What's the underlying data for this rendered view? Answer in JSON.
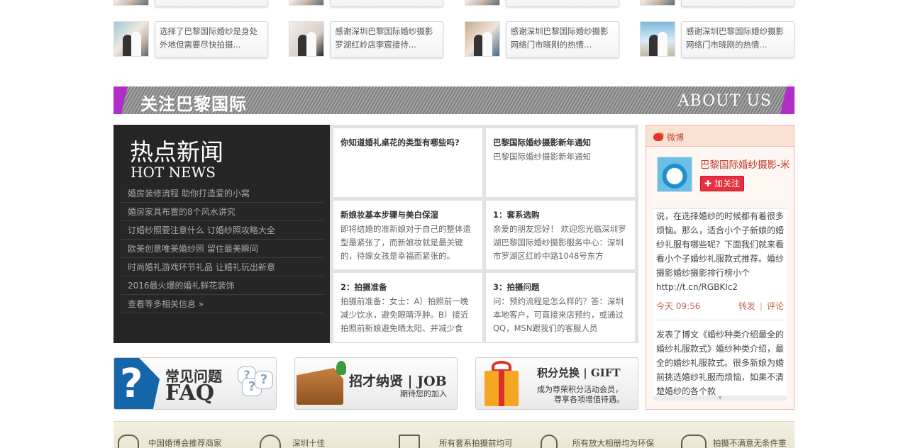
{
  "top_row_captions": [
    "",
    "",
    "",
    ""
  ],
  "thumbs": [
    {
      "caption": "选择了巴黎国际婚纱是身处外地但需要尽快拍摄..."
    },
    {
      "caption": "感谢深圳巴黎国际婚纱摄影罗湖红岭店李宸接待..."
    },
    {
      "caption": "感谢深圳巴黎国际婚纱摄影网络门市晓刚的热情..."
    },
    {
      "caption": "感谢深圳巴黎国际婚纱摄影网络门市晓刚的热情..."
    }
  ],
  "about_banner": {
    "title_cn": "关注巴黎国际",
    "title_en": "ABOUT US"
  },
  "hot_news": {
    "title_cn": "热点新闻",
    "title_en": "HOT NEWS",
    "items": [
      "婚房装修流程 助你打造爱的小窝",
      "婚房家具布置的8个风水讲究",
      "订婚纱照要注意什么 订婚纱照攻略大全",
      "欧美创意唯美婚纱照 留住最美瞬间",
      "时尚婚礼游戏环节礼品 让婚礼玩出新意",
      "2016最火爆的婚礼鲜花装饰",
      "查看等多相关信息 »"
    ]
  },
  "news_grid": [
    {
      "title": "你知道婚礼桌花的类型有哪些吗?",
      "body": ""
    },
    {
      "title": "巴黎国际婚纱摄影新年通知",
      "body": "巴黎国际婚纱摄影新年通知"
    },
    {
      "title": "新娘妆基本步骤与美白保湿",
      "body": "即将结婚的准新娘对于自己的整体造型最紧张了，而新娘妆就是最关键的，待嫁女孩是幸福而紧张的。"
    },
    {
      "title": "1：套系选购",
      "body": "亲爱的朋友您好！ 欢迎您光临深圳罗湖巴黎国际婚纱摄影服务中心：深圳市罗湖区红岭中路1048号东方"
    },
    {
      "title": "2：拍摄准备",
      "body": "拍摄前准备：女士：A）拍照前一晚减少饮水，避免眼睛浮肿。B）接近拍照前新娘避免晒太阳、并减少食"
    },
    {
      "title": "3：拍摄问题",
      "body": "问：预约流程是怎么样的？答：深圳本地客户，可直接来店预约，或通过QQ，MSN跟我们的客服人员"
    }
  ],
  "weibo": {
    "header": "微博",
    "account_name": "巴黎国际婚纱摄影-米",
    "follow_label": "加关注",
    "posts": [
      {
        "text": "说，在选择婚纱的时候都有着很多烦恼。那么，适合小个子新娘的婚纱礼服有哪些呢？下面我们就来看看小个子婚纱礼服款式推荐。婚纱摄影婚纱摄影排行榜小个http://t.cn/RGBKIc2",
        "time": "今天 09:56",
        "repost": "转发",
        "comment": "评论"
      },
      {
        "text": "发表了博文《婚纱种类介绍最全的婚纱礼服款式》婚纱种类介绍，最全的婚纱礼服款式。很多新娘为婚前挑选婚纱礼服而烦恼，如果不清楚婚纱的各个款",
        "time": "",
        "repost": "",
        "comment": ""
      }
    ]
  },
  "promos": {
    "faq": {
      "title_cn": "常见问题",
      "title_en": "FAQ"
    },
    "job": {
      "title": "招才纳贤 | JOB",
      "sub": "期待您的加入"
    },
    "gift": {
      "title": "积分兑换 | GIFT",
      "sub1": "成为尊荣积分活动会员，",
      "sub2": "尊享各项增值待遇。"
    }
  },
  "footer_items": [
    "中国婚博会推荐商家",
    "深圳十佳",
    "所有套系拍摄前均可",
    "所有放大相册均为环保",
    "拍摄不满意无条件重"
  ],
  "colors": {
    "accent_purple": "#b12dc7",
    "dark_panel": "#262626",
    "weibo_red": "#e8303f",
    "faq_blue": "#1565a9"
  }
}
